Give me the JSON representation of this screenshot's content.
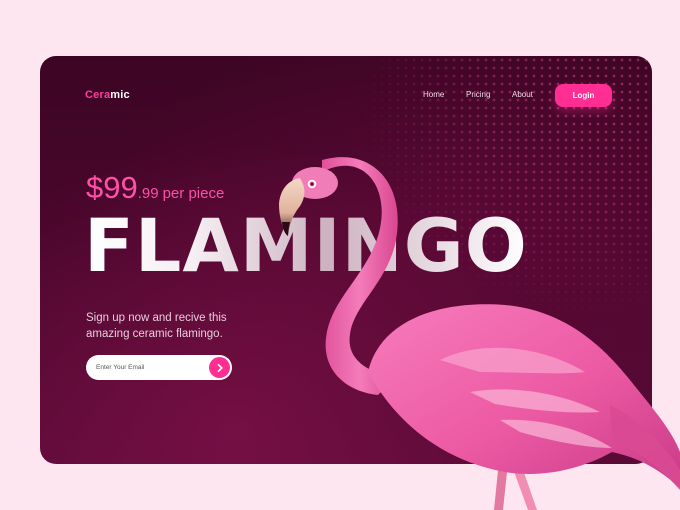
{
  "nav": {
    "logo_accent": "Cera",
    "logo_rest": "mic",
    "links": [
      "Home",
      "Pricing",
      "About"
    ],
    "login_label": "Login"
  },
  "hero": {
    "price_main": "$99",
    "price_cents": ".99",
    "price_unit": "per piece",
    "headline": "FLAMINGO",
    "subtext_line1": "Sign up now and recive this",
    "subtext_line2": "amazing ceramic flamingo.",
    "email_placeholder": "Enter Your Email",
    "submit_icon": "chevron-right-icon"
  },
  "colors": {
    "background": "#fde6ef",
    "card": "#45062a",
    "accent": "#ff2e93",
    "flamingo": "#ee5fa7"
  }
}
